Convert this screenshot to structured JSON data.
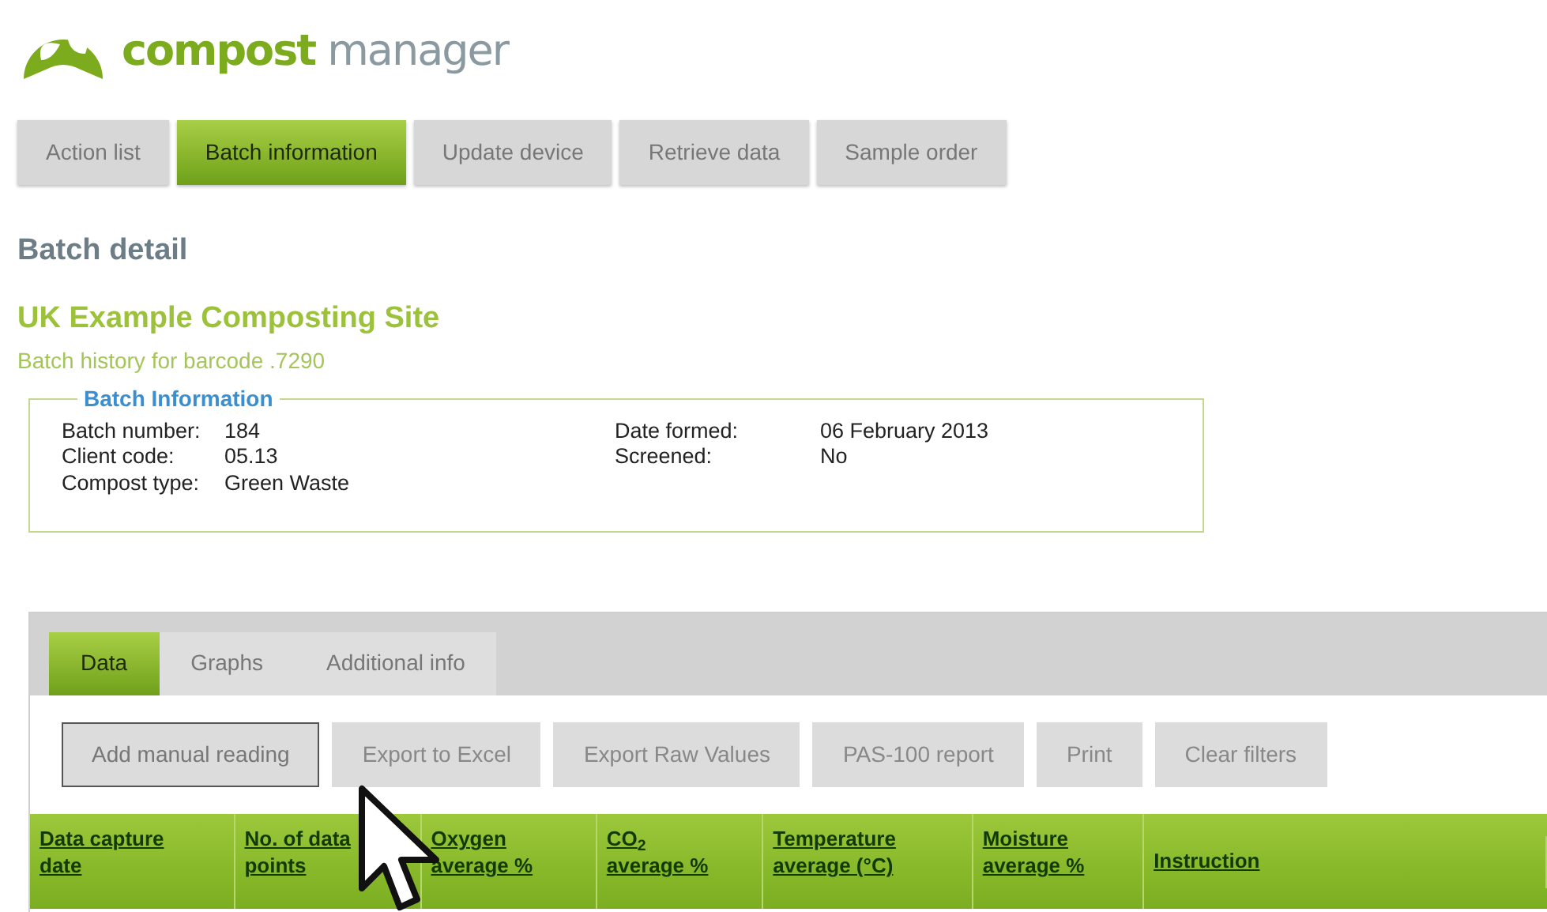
{
  "logo": {
    "bold": "compost",
    "light": "manager"
  },
  "nav_tabs": [
    {
      "label": "Action list",
      "selected": false
    },
    {
      "label": "Batch information",
      "selected": true
    },
    {
      "label": "Update device",
      "selected": false
    },
    {
      "label": "Retrieve data",
      "selected": false
    },
    {
      "label": "Sample order",
      "selected": false
    }
  ],
  "page_title": "Batch detail",
  "site_name": "UK Example Composting Site",
  "barcode_line": "Batch history for barcode .7290",
  "batch_info": {
    "legend": "Batch Information",
    "left": [
      {
        "label": "Batch number:",
        "value": "184"
      },
      {
        "label": "Client code:",
        "value": "05.13"
      },
      {
        "label": "Compost type:",
        "value": "Green Waste"
      }
    ],
    "right": [
      {
        "label": "Date formed:",
        "value": "06 February 2013"
      },
      {
        "label": "Screened:",
        "value": "No"
      }
    ]
  },
  "data_tabs": [
    {
      "label": "Data",
      "selected": true
    },
    {
      "label": "Graphs",
      "selected": false
    },
    {
      "label": "Additional info",
      "selected": false
    }
  ],
  "buttons": [
    {
      "label": "Add manual reading",
      "selected": true
    },
    {
      "label": "Export to Excel",
      "selected": false
    },
    {
      "label": "Export Raw Values",
      "selected": false
    },
    {
      "label": "PAS-100 report",
      "selected": false
    },
    {
      "label": "Print",
      "selected": false
    },
    {
      "label": "Clear filters",
      "selected": false
    }
  ],
  "table": {
    "columns": [
      "Data capture date",
      "No. of data points",
      "Oxygen average %",
      "CO$_{2}$ average %",
      "Temperature average (°C)",
      "Moisture average %",
      "Instruction"
    ]
  }
}
